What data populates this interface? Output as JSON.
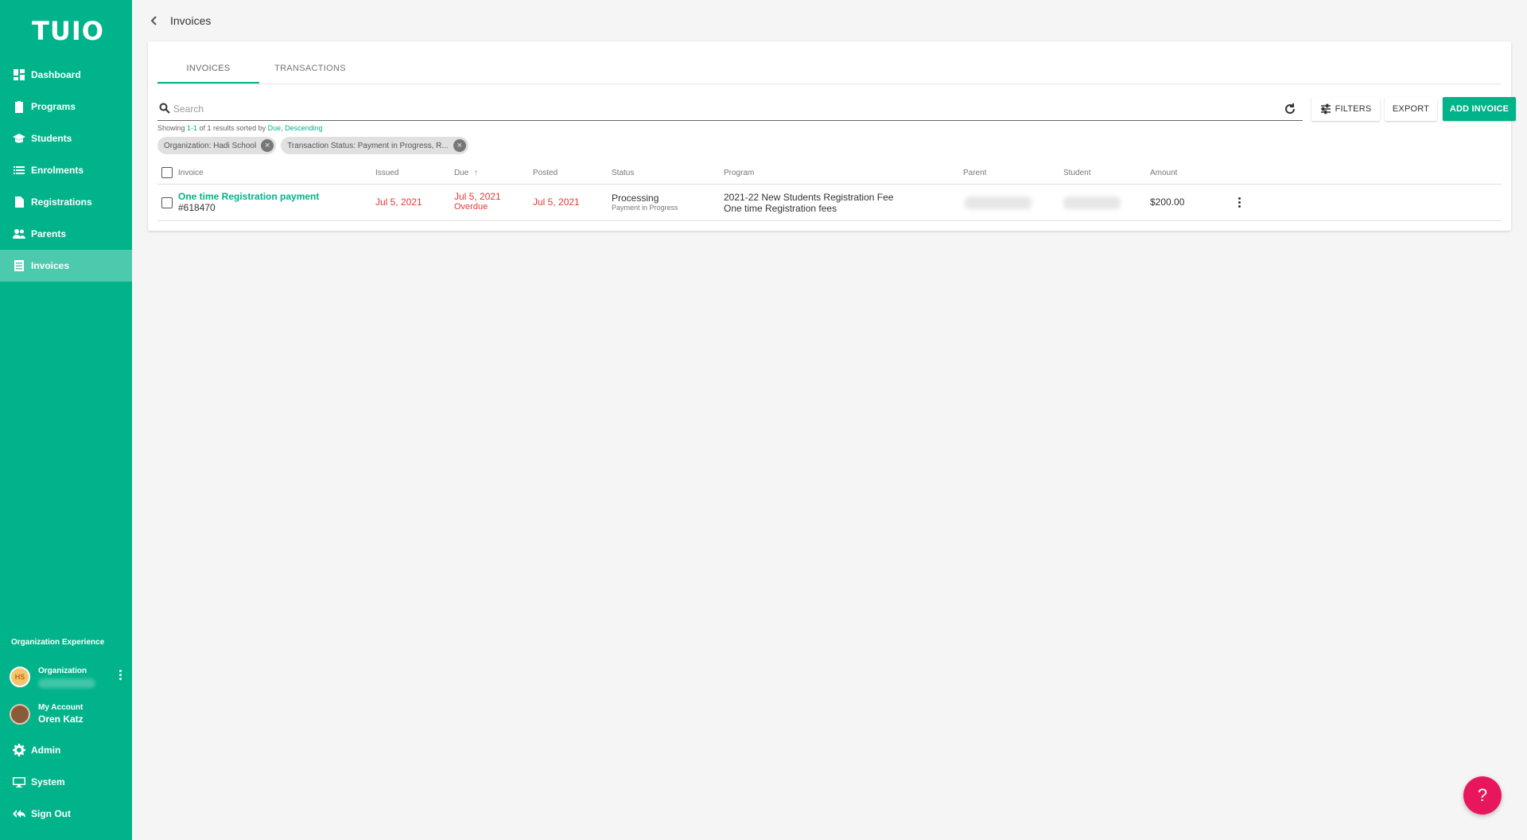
{
  "app": {
    "logo_text": "TUIO"
  },
  "sidebar": {
    "items": [
      {
        "label": "Dashboard",
        "icon": "dashboard-icon"
      },
      {
        "label": "Programs",
        "icon": "clipboard-icon"
      },
      {
        "label": "Students",
        "icon": "graduation-cap-icon"
      },
      {
        "label": "Enrolments",
        "icon": "list-icon"
      },
      {
        "label": "Registrations",
        "icon": "document-icon"
      },
      {
        "label": "Parents",
        "icon": "people-icon"
      },
      {
        "label": "Invoices",
        "icon": "invoice-icon",
        "active": true
      }
    ],
    "org_experience_label": "Organization Experience",
    "organization": {
      "label": "Organization"
    },
    "account": {
      "label": "My Account",
      "name": "Oren Katz"
    },
    "bottom_items": [
      {
        "label": "Admin",
        "icon": "gear-icon"
      },
      {
        "label": "System",
        "icon": "monitor-icon"
      },
      {
        "label": "Sign Out",
        "icon": "reply-all-icon"
      }
    ]
  },
  "header": {
    "title": "Invoices"
  },
  "tabs": [
    {
      "label": "INVOICES",
      "active": true
    },
    {
      "label": "TRANSACTIONS",
      "active": false
    }
  ],
  "search": {
    "placeholder": "Search",
    "value": ""
  },
  "toolbar": {
    "filters_label": "FILTERS",
    "export_label": "EXPORT",
    "add_label": "ADD INVOICE"
  },
  "results": {
    "prefix": "Showing ",
    "range": "1-1",
    "middle": " of 1 results sorted by ",
    "sort_field": "Due",
    "comma": ", ",
    "sort_dir": "Descending"
  },
  "chips": [
    {
      "label": "Organization: Hadi School"
    },
    {
      "label": "Transaction Status: Payment in Progress, R..."
    }
  ],
  "table": {
    "headers": {
      "invoice": "Invoice",
      "issued": "Issued",
      "due": "Due",
      "posted": "Posted",
      "status": "Status",
      "program": "Program",
      "parent": "Parent",
      "student": "Student",
      "amount": "Amount"
    },
    "rows": [
      {
        "invoice_title": "One time Registration payment",
        "invoice_number": "#618470",
        "issued": "Jul 5, 2021",
        "due": "Jul 5, 2021",
        "due_note": "Overdue",
        "posted": "Jul 5, 2021",
        "status": "Processing",
        "status_sub": "Payment in Progress",
        "program_line1": "2021-22 New Students Registration Fee",
        "program_line2": "One time Registration fees",
        "amount": "$200.00"
      }
    ]
  },
  "help": {
    "label": "?"
  },
  "colors": {
    "brand": "#00b38a",
    "danger": "#e53935",
    "help": "#e8175d"
  }
}
